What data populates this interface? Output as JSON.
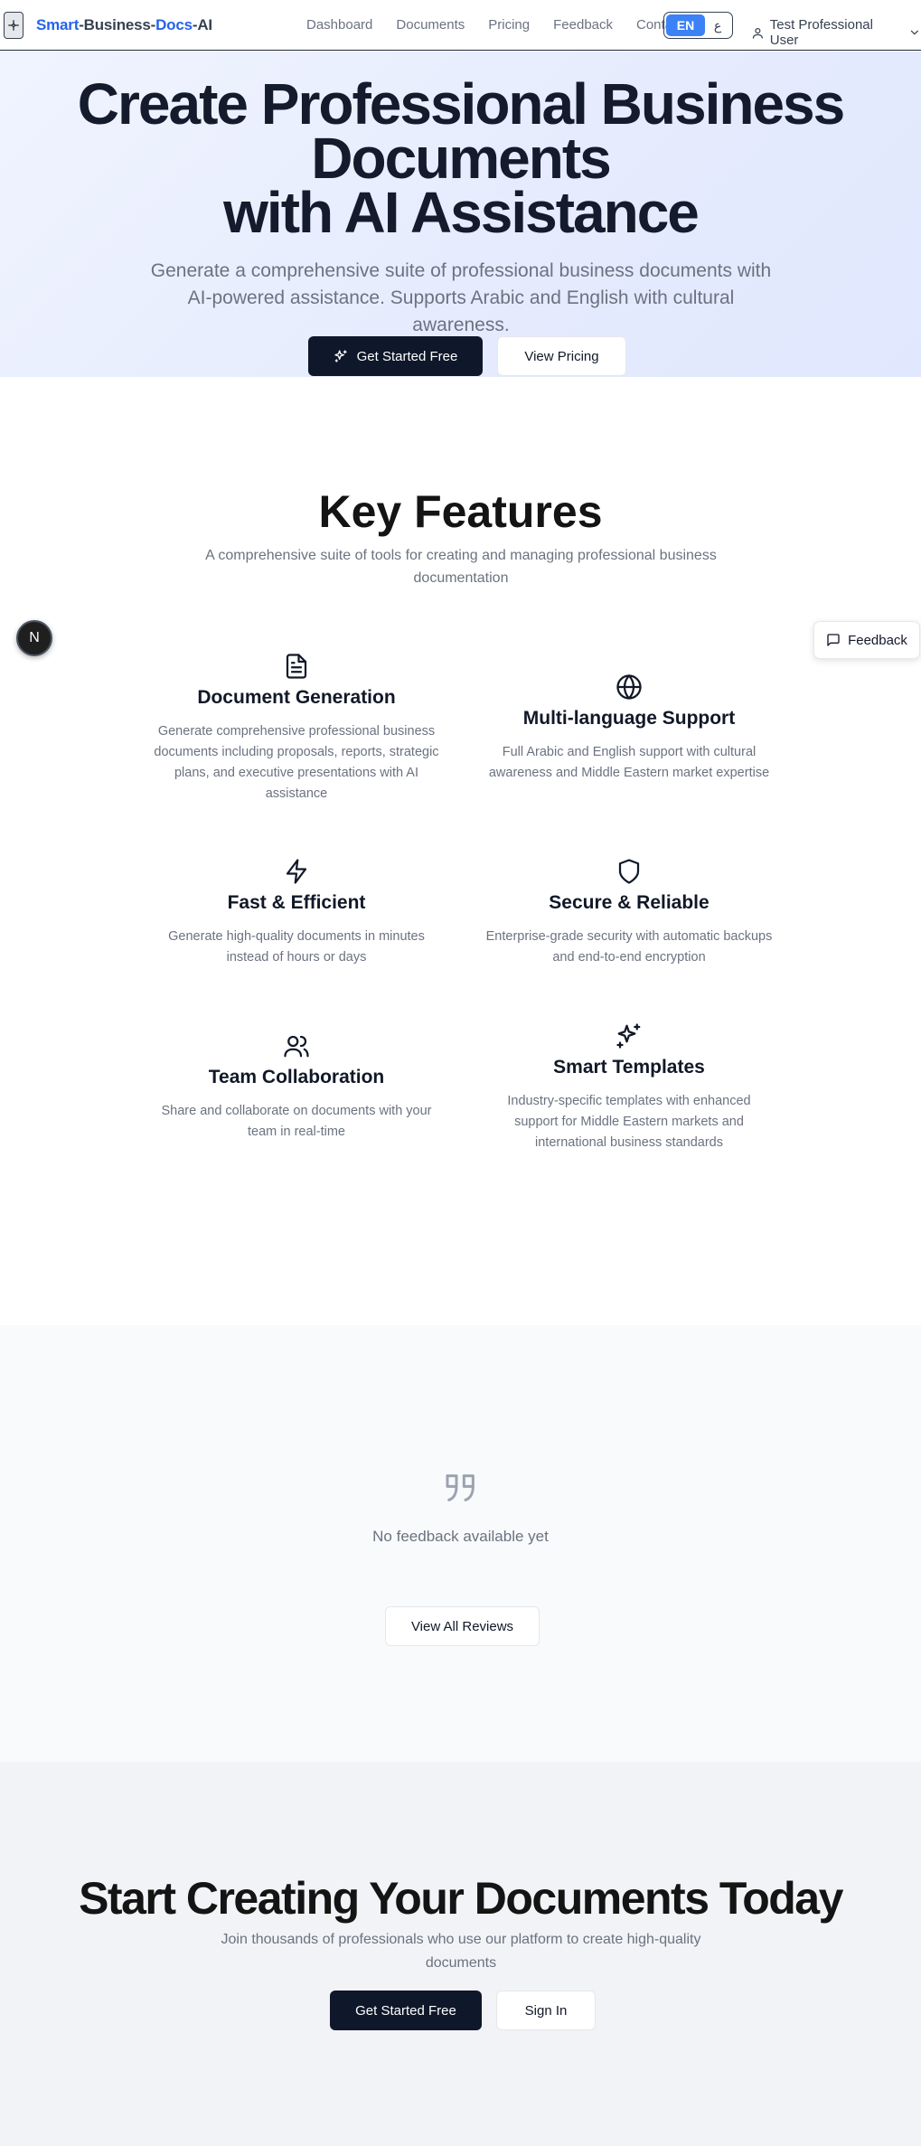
{
  "navbar": {
    "brand_parts": [
      "Smart",
      "-Business-",
      "Docs",
      "-AI"
    ],
    "links": [
      "Dashboard",
      "Documents",
      "Pricing",
      "Feedback",
      "Contact"
    ],
    "lang_en": "EN",
    "lang_ar": "ع",
    "user_name": "Test Professional User"
  },
  "hero": {
    "title_line1": "Create Professional Business",
    "title_line2": "Documents",
    "title_line3": "with AI Assistance",
    "subtitle": "Generate a comprehensive suite of professional business documents with AI-powered assistance. Supports Arabic and English with cultural awareness.",
    "cta_label": "Get Started Free",
    "pricing_label": "View Pricing"
  },
  "features": {
    "title": "Key Features",
    "subtitle": "A comprehensive suite of tools for creating and managing professional business documentation",
    "items": [
      {
        "name": "Document Generation",
        "desc": "Generate comprehensive professional business documents including proposals, reports, strategic plans, and executive presentations with AI assistance",
        "icon": "file-text-icon"
      },
      {
        "name": "Multi-language Support",
        "desc": "Full Arabic and English support with cultural awareness and Middle Eastern market expertise",
        "icon": "globe-icon"
      },
      {
        "name": "Fast & Efficient",
        "desc": "Generate high-quality documents in minutes instead of hours or days",
        "icon": "zap-icon"
      },
      {
        "name": "Secure & Reliable",
        "desc": "Enterprise-grade security with automatic backups and end-to-end encryption",
        "icon": "shield-icon"
      },
      {
        "name": "Team Collaboration",
        "desc": "Share and collaborate on documents with your team in real-time",
        "icon": "users-icon"
      },
      {
        "name": "Smart Templates",
        "desc": "Industry-specific templates with enhanced support for Middle Eastern markets and international business standards",
        "icon": "sparkles-icon"
      }
    ]
  },
  "floating": {
    "next_badge": "N",
    "feedback_label": "Feedback"
  },
  "testimonials": {
    "empty_text": "No feedback available yet",
    "view_all_label": "View All Reviews"
  },
  "cta": {
    "title": "Start Creating Your Documents Today",
    "subtitle": "Join thousands of professionals who use our platform to create high-quality documents",
    "start_label": "Get Started Free",
    "signin_label": "Sign In"
  },
  "colors": {
    "accent_blue": "#2563eb",
    "dark_button": "#0f172a",
    "lang_active": "#3b82f6"
  }
}
